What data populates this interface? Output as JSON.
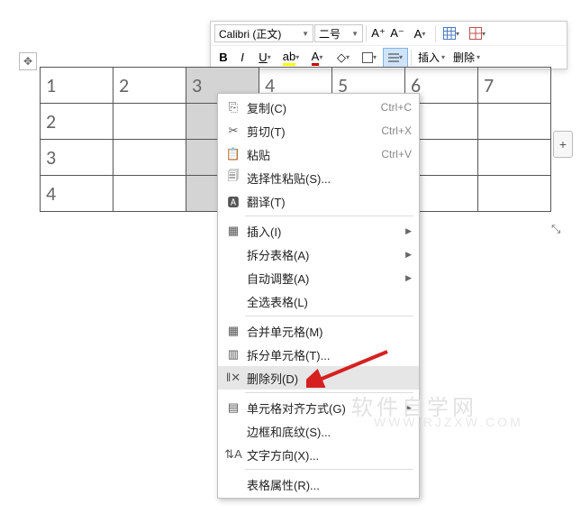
{
  "toolbar": {
    "font_name": "Calibri (正文)",
    "font_size": "二号",
    "grow_font": "A⁺",
    "shrink_font": "A⁻",
    "clear_fmt": "A",
    "insert_label": "插入",
    "delete_label": "删除",
    "bold": "B",
    "italic": "I",
    "underline": "U"
  },
  "table": {
    "headers": [
      "1",
      "2",
      "3",
      "4",
      "5",
      "6",
      "7"
    ],
    "rows": [
      "2",
      "3",
      "4"
    ],
    "selected_col": 2
  },
  "context_menu": {
    "copy": "复制(C)",
    "copy_sc": "Ctrl+C",
    "cut": "剪切(T)",
    "cut_sc": "Ctrl+X",
    "paste": "粘贴",
    "paste_sc": "Ctrl+V",
    "paste_special": "选择性粘贴(S)...",
    "translate": "翻译(T)",
    "insert": "插入(I)",
    "split_table": "拆分表格(A)",
    "autofit": "自动调整(A)",
    "select_table": "全选表格(L)",
    "merge_cells": "合并单元格(M)",
    "split_cells": "拆分单元格(T)...",
    "delete_col": "删除列(D)",
    "cell_align": "单元格对齐方式(G)",
    "border_shade": "边框和底纹(S)...",
    "text_dir": "文字方向(X)...",
    "table_props": "表格属性(R)..."
  },
  "watermark": "软件自学网",
  "watermark_url": "WWW.RJZXW.COM"
}
